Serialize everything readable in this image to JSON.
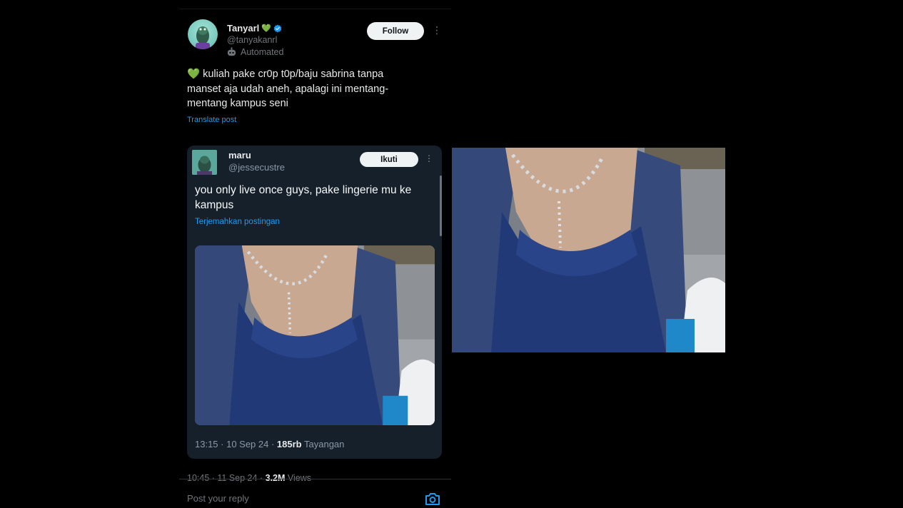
{
  "post": {
    "author_name": "Tanyarl",
    "author_handle": "@tanyakanrl",
    "automated_label": "Automated",
    "follow_label": "Follow",
    "more_label": "⋮",
    "heart_emoji": "💚",
    "text": "kuliah pake cr0p t0p/baju sabrina tanpa manset aja udah aneh, apalagi ini mentang-mentang kampus seni",
    "translate_label": "Translate post",
    "timestamp": "10:45 · 11 Sep 24 · ",
    "views_count": "3.2M",
    "views_label": " Views",
    "reply_placeholder": "Post your reply"
  },
  "quote": {
    "author_name": "maru",
    "author_handle": "@jessecustre",
    "follow_label": "Ikuti",
    "more_label": "⋮",
    "text": "you only live once guys, pake lingerie mu ke kampus",
    "translate_label": "Terjemahkan postingan",
    "timestamp": "13:15 · 10 Sep 24 · ",
    "views_count": "185rb",
    "views_label": " Tayangan"
  },
  "colors": {
    "background": "#000000",
    "quote_card": "#15202b",
    "link_blue": "#1d9bf0",
    "verified_blue": "#1d9bf0"
  },
  "icons": {
    "verified": "verified-badge-icon",
    "automated": "robot-icon",
    "camera": "camera-icon",
    "more": "more-icon"
  }
}
